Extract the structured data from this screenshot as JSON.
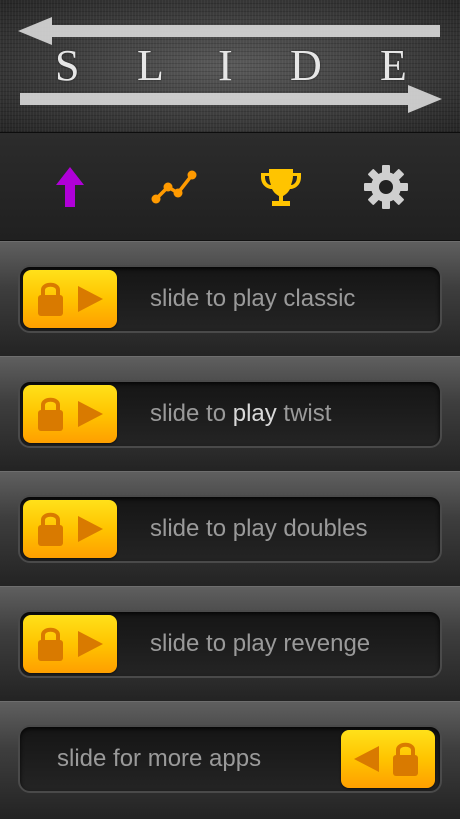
{
  "header": {
    "title_letters": [
      "S",
      "L",
      "I",
      "D",
      "E"
    ]
  },
  "toolbar": {
    "items": [
      {
        "icon": "up-arrow-icon",
        "color": "#b000d8"
      },
      {
        "icon": "stats-chart-icon",
        "color": "#ff9a00"
      },
      {
        "icon": "trophy-icon",
        "color": "#ffc400"
      },
      {
        "icon": "gear-icon",
        "color": "#cfcfcf"
      }
    ]
  },
  "sliders": [
    {
      "prefix": "slide to ",
      "highlight": "play",
      "suffix": " classic",
      "knob_side": "left",
      "highlight_on": false
    },
    {
      "prefix": "slide to ",
      "highlight": "play",
      "suffix": " twist",
      "knob_side": "left",
      "highlight_on": true
    },
    {
      "prefix": "slide to ",
      "highlight": "play",
      "suffix": " doubles",
      "knob_side": "left",
      "highlight_on": false
    },
    {
      "prefix": "slide to ",
      "highlight": "play",
      "suffix": " revenge",
      "knob_side": "left",
      "highlight_on": false
    },
    {
      "prefix": "slide for more apps",
      "highlight": "",
      "suffix": "",
      "knob_side": "right",
      "highlight_on": false
    }
  ],
  "colors": {
    "knob_top": "#ffe11a",
    "knob_bottom": "#ff9f00",
    "knob_glyph": "#d97a00",
    "label": "#9a9a9a",
    "label_highlight": "#d9d9d9"
  }
}
